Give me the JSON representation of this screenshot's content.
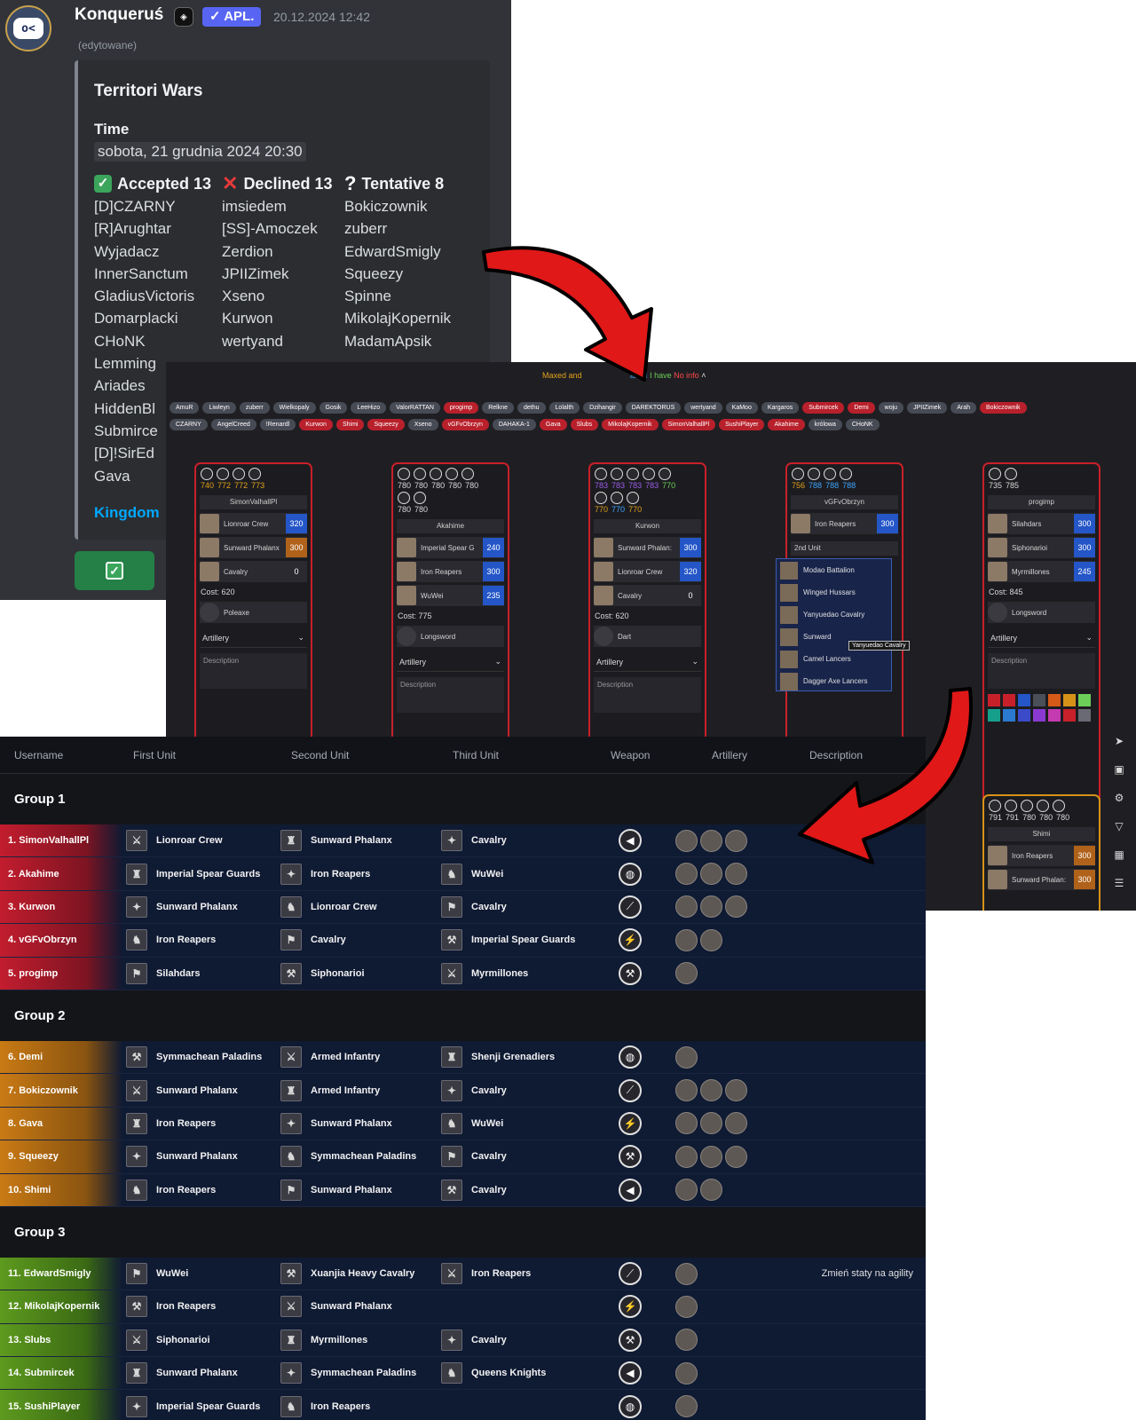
{
  "discord": {
    "username": "Konqueruś",
    "app_badge": "APL.",
    "timestamp": "20.12.2024 12:42",
    "edited": "(edytowane)",
    "embed": {
      "title": "Territori Wars",
      "time_label": "Time",
      "time_value": "sobota, 21 grudnia 2024 20:30",
      "accepted_label": "Accepted 13",
      "declined_label": "Declined 13",
      "tentative_label": "Tentative 8",
      "accepted": [
        "[D]CZARNY",
        "[R]Arughtar",
        "Wyjadacz",
        "InnerSanctum",
        "GladiusVictoris",
        "Domarplacki",
        "CHoNK",
        "Lemming",
        "Ariades",
        "HiddenBl",
        "Submirce",
        "[D]!SirEd",
        "Gava"
      ],
      "declined": [
        "imsiedem",
        "[SS]-Amoczek",
        "Zerdion",
        "JPIIZimek",
        "Xseno",
        "Kurwon",
        "wertyand"
      ],
      "tentative": [
        "Bokiczownik",
        "zuberr",
        "EdwardSmigly",
        "Squeezy",
        "Spinne",
        "MikolajKopernik",
        "MadamApsik"
      ],
      "footer_link": "Kingdom"
    }
  },
  "planner": {
    "legend": {
      "maxed": "Maxed and",
      "have_maxed": "axed",
      "have": "I have",
      "no_info": "No info"
    },
    "pills_row1": [
      {
        "t": "AmuR",
        "c": "gray"
      },
      {
        "t": "Liwleyn",
        "c": "gray"
      },
      {
        "t": "zuberr",
        "c": "gray"
      },
      {
        "t": "Wielkopaly",
        "c": "gray"
      },
      {
        "t": "Gosik",
        "c": "gray"
      },
      {
        "t": "LeeHizo",
        "c": "gray"
      },
      {
        "t": "ValorRATTAN",
        "c": "gray"
      },
      {
        "t": "progimp",
        "c": "red"
      },
      {
        "t": "Relkne",
        "c": "gray"
      },
      {
        "t": "dethu",
        "c": "gray"
      },
      {
        "t": "Lolalth",
        "c": "gray"
      },
      {
        "t": "Dzihangir",
        "c": "gray"
      },
      {
        "t": "DAREKTORUS",
        "c": "gray"
      },
      {
        "t": "wertyand",
        "c": "gray"
      },
      {
        "t": "KaMoo",
        "c": "gray"
      },
      {
        "t": "Kargaros",
        "c": "gray"
      },
      {
        "t": "Submircek",
        "c": "red"
      },
      {
        "t": "Demi",
        "c": "red"
      },
      {
        "t": "woju",
        "c": "gray"
      },
      {
        "t": "JPIIZimek",
        "c": "gray"
      },
      {
        "t": "Arah",
        "c": "gray"
      },
      {
        "t": "Bokiczownik",
        "c": "red"
      }
    ],
    "pills_row2": [
      {
        "t": "CZARNY",
        "c": "gray"
      },
      {
        "t": "AngelCreed",
        "c": "gray"
      },
      {
        "t": "!Renardl",
        "c": "gray"
      },
      {
        "t": "Kurwon",
        "c": "red"
      },
      {
        "t": "Shimi",
        "c": "red"
      },
      {
        "t": "Squeezy",
        "c": "red"
      },
      {
        "t": "Xseno",
        "c": "gray"
      },
      {
        "t": "vGFvObrzyn",
        "c": "red"
      },
      {
        "t": "DAHAKA-1",
        "c": "gray"
      },
      {
        "t": "Gava",
        "c": "red"
      },
      {
        "t": "Slubs",
        "c": "red"
      },
      {
        "t": "MikolajKopernik",
        "c": "red"
      },
      {
        "t": "SimonValhallPl",
        "c": "red"
      },
      {
        "t": "SushiPlayer",
        "c": "red"
      },
      {
        "t": "Akahime",
        "c": "red"
      },
      {
        "t": "królowa",
        "c": "gray"
      },
      {
        "t": "CHoNK",
        "c": "gray"
      }
    ],
    "cards": [
      {
        "nums": [
          "740",
          "772",
          "772",
          "773"
        ],
        "name": "SimonValhallPl",
        "units": [
          [
            "Lionroar Crew",
            "320",
            "b"
          ],
          [
            "Sunward Phalanx",
            "300",
            "o"
          ],
          [
            "Cavalry",
            "0",
            "n"
          ]
        ],
        "cost": "Cost: 620",
        "weapon": "Poleaxe"
      },
      {
        "nums": [
          "780",
          "780",
          "780",
          "780",
          "780"
        ],
        "nums2": [
          "780",
          "780"
        ],
        "name": "Akahime",
        "units": [
          [
            "Imperial Spear G",
            "240",
            "b"
          ],
          [
            "Iron Reapers",
            "300",
            "b"
          ],
          [
            "WuWei",
            "235",
            "b"
          ]
        ],
        "cost": "Cost: 775",
        "weapon": "Longsword"
      },
      {
        "nums": [
          "783",
          "783",
          "783",
          "783",
          "770"
        ],
        "nums2": [
          "770",
          "770",
          "770"
        ],
        "name": "Kurwon",
        "units": [
          [
            "Sunward Phalan:",
            "300",
            "b"
          ],
          [
            "Lionroar Crew",
            "320",
            "b"
          ],
          [
            "Cavalry",
            "0",
            "n"
          ]
        ],
        "cost": "Cost: 620",
        "weapon": "Dart"
      },
      {
        "nums": [
          "756",
          "788",
          "788",
          "788"
        ],
        "name": "vGFvObrzyn",
        "units": [
          [
            "Iron Reapers",
            "300",
            "b"
          ]
        ],
        "second": "2nd Unit"
      },
      {
        "nums": [
          "735",
          "785"
        ],
        "name": "progimp",
        "units": [
          [
            "Silahdars",
            "300",
            "b"
          ],
          [
            "Siphonarioi",
            "300",
            "b"
          ],
          [
            "Myrmillones",
            "245",
            "b"
          ]
        ],
        "cost": "Cost: 845",
        "weapon": "Longsword"
      }
    ],
    "card6": {
      "nums": [
        "791",
        "791",
        "780",
        "780",
        "780"
      ],
      "name": "Shimi",
      "units": [
        [
          "Iron Reapers",
          "300",
          "o"
        ],
        [
          "Sunward Phalan:",
          "300",
          "o"
        ]
      ]
    },
    "artillery_label": "Artillery",
    "description_label": "Description",
    "dropdown": [
      "Modao Battalion",
      "Winged Hussars",
      "Yanyuedao Cavalry",
      "Sunward",
      "Camel Lancers",
      "Dagger Axe Lancers"
    ],
    "tooltip": "Yanyuedao Cavalry",
    "swatch_colors": [
      "#c8202a",
      "#c8202a",
      "#2456c8",
      "#4a4f58",
      "#d65a18",
      "#d69218",
      "#6ccf58",
      "#16a08c",
      "#2a7ad0",
      "#3b4ac8",
      "#8a3ad0",
      "#c43ab0",
      "#c8202a",
      "#6a6a74"
    ]
  },
  "groups_table": {
    "columns": [
      "Username",
      "First Unit",
      "Second Unit",
      "Third Unit",
      "Weapon",
      "Artillery",
      "Description"
    ],
    "groups": [
      {
        "title": "Group 1",
        "cls": "g1",
        "rows": [
          {
            "n": "1. SimonValhallPl",
            "u1": "Lionroar Crew",
            "u2": "Sunward Phalanx",
            "u3": "Cavalry",
            "art": 3,
            "desc": ""
          },
          {
            "n": "2. Akahime",
            "u1": "Imperial Spear Guards",
            "u2": "Iron Reapers",
            "u3": "WuWei",
            "art": 3,
            "desc": ""
          },
          {
            "n": "3. Kurwon",
            "u1": "Sunward Phalanx",
            "u2": "Lionroar Crew",
            "u3": "Cavalry",
            "art": 3,
            "desc": ""
          },
          {
            "n": "4. vGFvObrzyn",
            "u1": "Iron Reapers",
            "u2": "Cavalry",
            "u3": "Imperial Spear Guards",
            "art": 2,
            "desc": ""
          },
          {
            "n": "5. progimp",
            "u1": "Silahdars",
            "u2": "Siphonarioi",
            "u3": "Myrmillones",
            "art": 1,
            "desc": ""
          }
        ]
      },
      {
        "title": "Group 2",
        "cls": "g2",
        "rows": [
          {
            "n": "6. Demi",
            "u1": "Symmachean Paladins",
            "u2": "Armed Infantry",
            "u3": "Shenji Grenadiers",
            "art": 1,
            "desc": ""
          },
          {
            "n": "7. Bokiczownik",
            "u1": "Sunward Phalanx",
            "u2": "Armed Infantry",
            "u3": "Cavalry",
            "art": 3,
            "desc": ""
          },
          {
            "n": "8. Gava",
            "u1": "Iron Reapers",
            "u2": "Sunward Phalanx",
            "u3": "WuWei",
            "art": 3,
            "desc": ""
          },
          {
            "n": "9. Squeezy",
            "u1": "Sunward Phalanx",
            "u2": "Symmachean Paladins",
            "u3": "Cavalry",
            "art": 3,
            "desc": ""
          },
          {
            "n": "10. Shimi",
            "u1": "Iron Reapers",
            "u2": "Sunward Phalanx",
            "u3": "Cavalry",
            "art": 2,
            "desc": ""
          }
        ]
      },
      {
        "title": "Group 3",
        "cls": "g3",
        "rows": [
          {
            "n": "11. EdwardSmigly",
            "u1": "WuWei",
            "u2": "Xuanjia Heavy Cavalry",
            "u3": "Iron Reapers",
            "art": 1,
            "desc": "Zmień staty na agility"
          },
          {
            "n": "12. MikolajKopernik",
            "u1": "Iron Reapers",
            "u2": "Sunward Phalanx",
            "u3": "",
            "art": 1,
            "desc": ""
          },
          {
            "n": "13. Slubs",
            "u1": "Siphonarioi",
            "u2": "Myrmillones",
            "u3": "Cavalry",
            "art": 1,
            "desc": ""
          },
          {
            "n": "14. Submircek",
            "u1": "Sunward Phalanx",
            "u2": "Symmachean Paladins",
            "u3": "Queens Knights",
            "art": 1,
            "desc": ""
          },
          {
            "n": "15. SushiPlayer",
            "u1": "Imperial Spear Guards",
            "u2": "Iron Reapers",
            "u3": "",
            "art": 1,
            "desc": ""
          }
        ]
      }
    ]
  }
}
